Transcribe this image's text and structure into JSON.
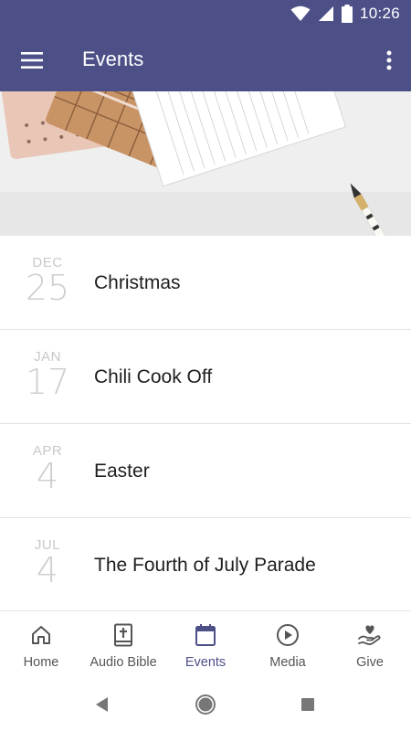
{
  "status_bar": {
    "time": "10:26"
  },
  "app_bar": {
    "title": "Events"
  },
  "events": [
    {
      "month": "DEC",
      "day": "25",
      "title": "Christmas"
    },
    {
      "month": "JAN",
      "day": "17",
      "title": "Chili Cook Off"
    },
    {
      "month": "APR",
      "day": "4",
      "title": "Easter"
    },
    {
      "month": "JUL",
      "day": "4",
      "title": "The Fourth of July Parade"
    }
  ],
  "bottom_nav": [
    {
      "label": "Home",
      "icon": "home-icon",
      "active": false
    },
    {
      "label": "Audio Bible",
      "icon": "bible-icon",
      "active": false
    },
    {
      "label": "Events",
      "icon": "calendar-icon",
      "active": true
    },
    {
      "label": "Media",
      "icon": "play-circle-icon",
      "active": false
    },
    {
      "label": "Give",
      "icon": "give-hand-heart-icon",
      "active": false
    }
  ],
  "colors": {
    "primary": "#4d5087",
    "nav_inactive": "#555555",
    "date_gray": "#c8c8c8"
  }
}
